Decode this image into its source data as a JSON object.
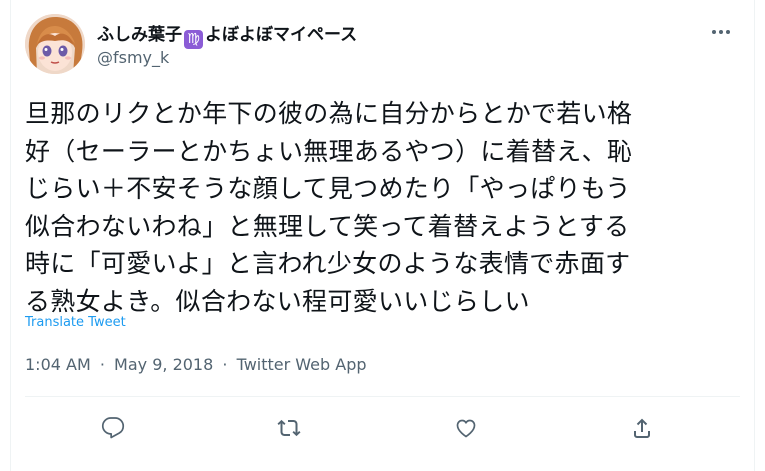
{
  "tweet": {
    "display_name_pre": "ふしみ葉子",
    "zodiac_glyph": "♍",
    "display_name_post": "よぼよぼマイペース",
    "handle": "@fsmy_k",
    "text": "旦那のリクとか年下の彼の為に自分からとかで若い格\n好（セーラーとかちょい無理あるやつ）に着替え、恥\nじらい＋不安そうな顔して見つめたり「やっぱりもう\n似合わないわね」と無理して笑って着替えようとする\n時に「可愛いよ」と言われ少女のような表情で赤面す\nる熟女よき。似合わない程可愛いいじらしい",
    "translate_label": "Translate Tweet",
    "time": "1:04 AM",
    "date": "May 9, 2018",
    "source": "Twitter Web App",
    "separator": "·"
  },
  "icons": {
    "more": "more-horizontal-icon",
    "reply": "reply-icon",
    "retweet": "retweet-icon",
    "like": "heart-icon",
    "share": "share-icon"
  },
  "colors": {
    "accent": "#1d9bf0",
    "text": "#0f1419",
    "secondary": "#536471",
    "divider": "#eff3f4",
    "zodiac_badge": "#8b5cd6"
  }
}
